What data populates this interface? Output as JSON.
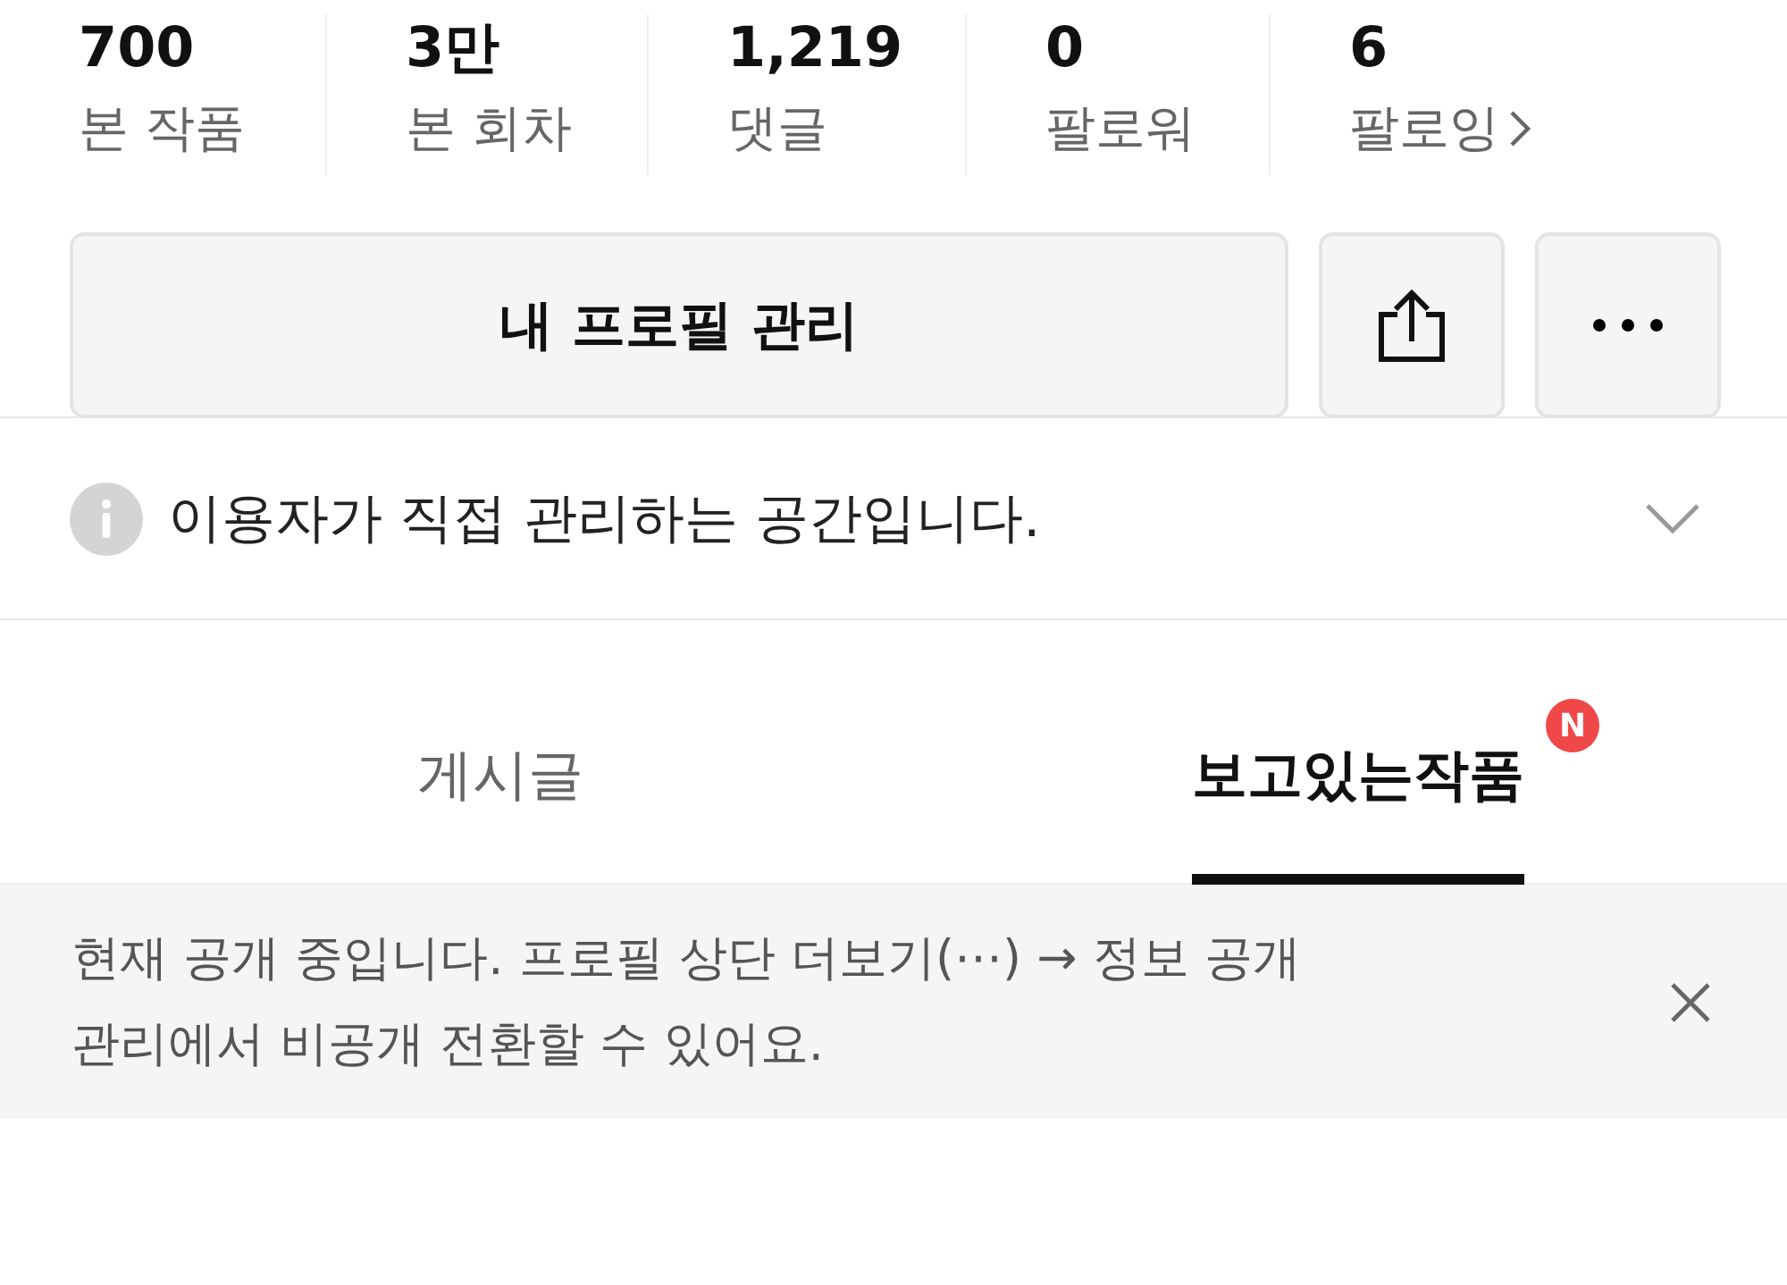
{
  "stats": [
    {
      "value": "700",
      "label": "본 작품",
      "kind": "plain"
    },
    {
      "value": "3만",
      "label": "본 회차",
      "kind": "plain"
    },
    {
      "value": "1,219",
      "label": "댓글",
      "kind": "plain"
    },
    {
      "value": "0",
      "label": "팔로워",
      "kind": "plain"
    },
    {
      "value": "6",
      "label": "팔로잉",
      "kind": "link"
    }
  ],
  "profile_button": "내 프로필 관리",
  "info": {
    "text": "이용자가 직접 관리하는 공간입니다.",
    "expanded": false
  },
  "tabs": [
    {
      "label": "게시글",
      "selected": false
    },
    {
      "label": "보고있는작품",
      "selected": true,
      "badge": "N"
    }
  ],
  "notice": {
    "text": "현재 공개 중입니다. 프로필 상단 더보기(⋯) → 정보 공개 관리에서 비공개 전환할 수 있어요."
  }
}
